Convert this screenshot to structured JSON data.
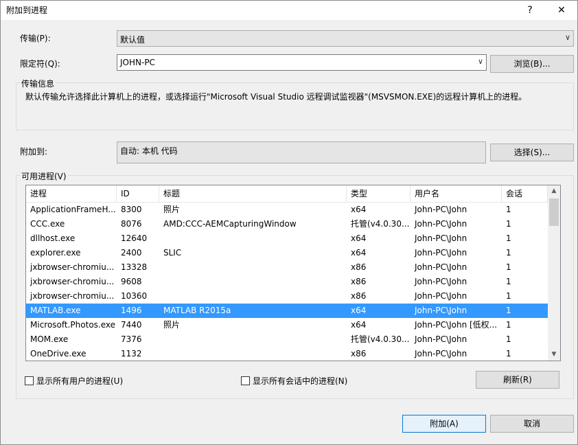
{
  "window": {
    "title": "附加到进程",
    "help_glyph": "?",
    "close_glyph": "✕"
  },
  "transport": {
    "label": "传输(P):",
    "value": "默认值"
  },
  "qualifier": {
    "label": "限定符(Q):",
    "value": "JOHN-PC",
    "browse_label": "浏览(B)..."
  },
  "transport_info": {
    "title": "传输信息",
    "text": "默认传输允许选择此计算机上的进程，或选择运行\"Microsoft Visual Studio 远程调试监视器\"(MSVSMON.EXE)的远程计算机上的进程。"
  },
  "attach_to": {
    "label": "附加到:",
    "value": "自动: 本机 代码",
    "select_label": "选择(S)..."
  },
  "available_processes": {
    "title": "可用进程(V)",
    "columns": [
      "进程",
      "ID",
      "标题",
      "类型",
      "用户名",
      "会话"
    ],
    "rows": [
      {
        "process": "ApplicationFrameH...",
        "id": "8300",
        "title": "照片",
        "type": "x64",
        "user": "John-PC\\John",
        "session": "1",
        "selected": false
      },
      {
        "process": "CCC.exe",
        "id": "8076",
        "title": "AMD:CCC-AEMCapturingWindow",
        "type": "托管(v4.0.30...",
        "user": "John-PC\\John",
        "session": "1",
        "selected": false
      },
      {
        "process": "dllhost.exe",
        "id": "12640",
        "title": "",
        "type": "x64",
        "user": "John-PC\\John",
        "session": "1",
        "selected": false
      },
      {
        "process": "explorer.exe",
        "id": "2400",
        "title": "SLIC",
        "type": "x64",
        "user": "John-PC\\John",
        "session": "1",
        "selected": false
      },
      {
        "process": "jxbrowser-chromiu...",
        "id": "13328",
        "title": "",
        "type": "x86",
        "user": "John-PC\\John",
        "session": "1",
        "selected": false
      },
      {
        "process": "jxbrowser-chromiu...",
        "id": "9608",
        "title": "",
        "type": "x86",
        "user": "John-PC\\John",
        "session": "1",
        "selected": false
      },
      {
        "process": "jxbrowser-chromiu...",
        "id": "10360",
        "title": "",
        "type": "x86",
        "user": "John-PC\\John",
        "session": "1",
        "selected": false
      },
      {
        "process": "MATLAB.exe",
        "id": "1496",
        "title": "MATLAB R2015a",
        "type": "x64",
        "user": "John-PC\\John",
        "session": "1",
        "selected": true
      },
      {
        "process": "Microsoft.Photos.exe",
        "id": "7440",
        "title": "照片",
        "type": "x64",
        "user": "John-PC\\John [低权...",
        "session": "1",
        "selected": false
      },
      {
        "process": "MOM.exe",
        "id": "7376",
        "title": "",
        "type": "托管(v4.0.30...",
        "user": "John-PC\\John",
        "session": "1",
        "selected": false
      },
      {
        "process": "OneDrive.exe",
        "id": "1132",
        "title": "",
        "type": "x86",
        "user": "John-PC\\John",
        "session": "1",
        "selected": false
      }
    ],
    "show_all_users_label": "显示所有用户的进程(U)",
    "show_all_sessions_label": "显示所有会话中的进程(N)",
    "refresh_label": "刷新(R)"
  },
  "footer": {
    "attach_label": "附加(A)",
    "cancel_label": "取消"
  }
}
